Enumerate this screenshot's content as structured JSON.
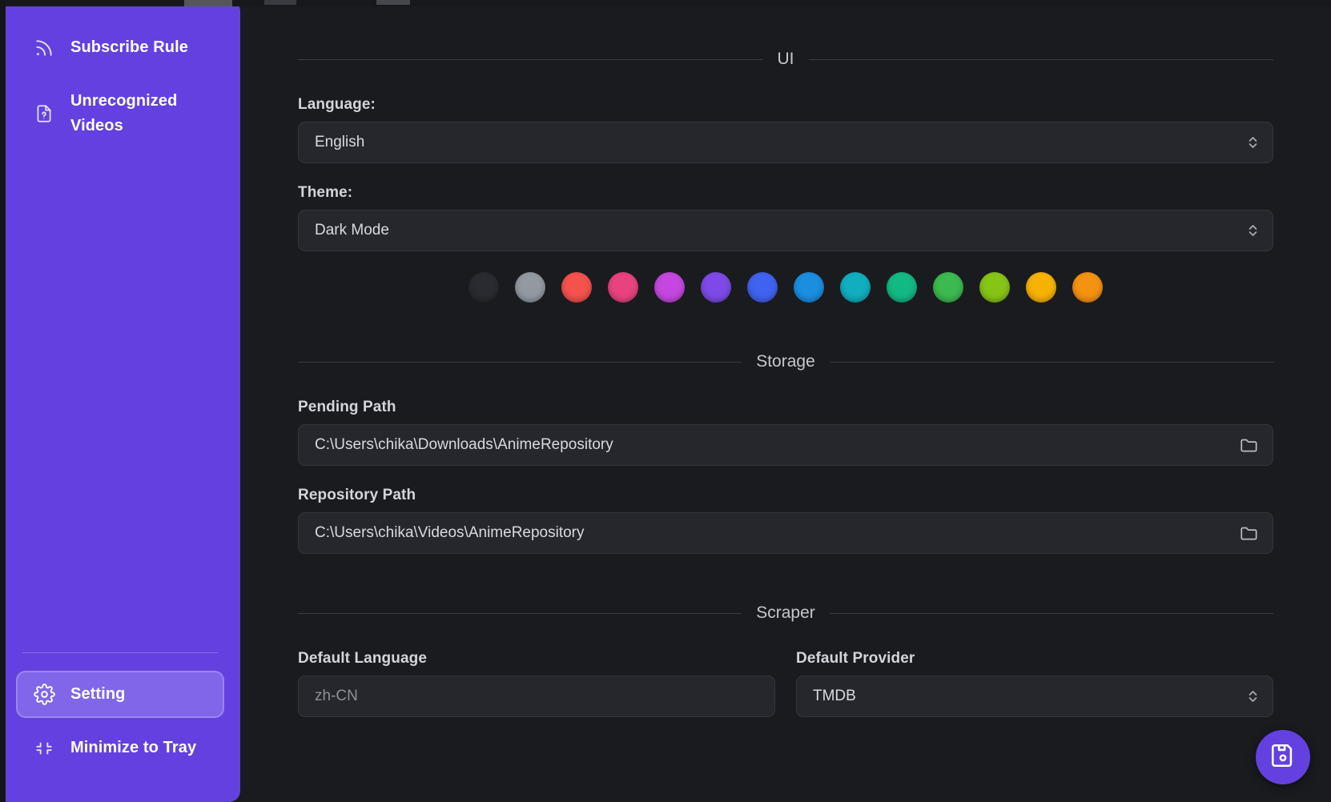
{
  "sidebar": {
    "top_items": [
      {
        "label": "Subscribe Rule",
        "icon": "rss-icon"
      },
      {
        "label": "Unrecognized Videos",
        "icon": "file-question-icon"
      }
    ],
    "bottom_items": [
      {
        "label": "Setting",
        "icon": "gear-icon",
        "active": true
      },
      {
        "label": "Minimize to Tray",
        "icon": "minimize-icon",
        "active": false
      }
    ],
    "background_color": "#6341e0",
    "active_background_color": "#8166ea"
  },
  "main": {
    "sections": [
      {
        "title": "UI"
      },
      {
        "title": "Storage"
      },
      {
        "title": "Scraper"
      }
    ],
    "ui": {
      "language_label": "Language:",
      "language_value": "English",
      "theme_label": "Theme:",
      "theme_value": "Dark Mode",
      "accent_swatches": [
        {
          "name": "black",
          "color": "#2a2b30"
        },
        {
          "name": "grey",
          "color": "#9399a1"
        },
        {
          "name": "red",
          "color": "#f4524d"
        },
        {
          "name": "pink",
          "color": "#e8437e"
        },
        {
          "name": "magenta",
          "color": "#c547e0"
        },
        {
          "name": "violet",
          "color": "#7d4ae8"
        },
        {
          "name": "indigo",
          "color": "#4062f0"
        },
        {
          "name": "blue",
          "color": "#1b8ee0"
        },
        {
          "name": "cyan",
          "color": "#11aec0"
        },
        {
          "name": "teal",
          "color": "#13b982"
        },
        {
          "name": "green",
          "color": "#3cb94f"
        },
        {
          "name": "lime",
          "color": "#86c417"
        },
        {
          "name": "amber",
          "color": "#f7b200"
        },
        {
          "name": "orange",
          "color": "#f59211"
        }
      ]
    },
    "storage": {
      "pending_path_label": "Pending Path",
      "pending_path_value": "C:\\Users\\chika\\Downloads\\AnimeRepository",
      "repository_path_label": "Repository Path",
      "repository_path_value": "C:\\Users\\chika\\Videos\\AnimeRepository"
    },
    "scraper": {
      "default_language_label": "Default Language",
      "default_language_value": "zh-CN",
      "default_provider_label": "Default Provider",
      "default_provider_value": "TMDB"
    }
  },
  "save_button": {
    "icon": "save-icon",
    "color": "#6341e0"
  }
}
